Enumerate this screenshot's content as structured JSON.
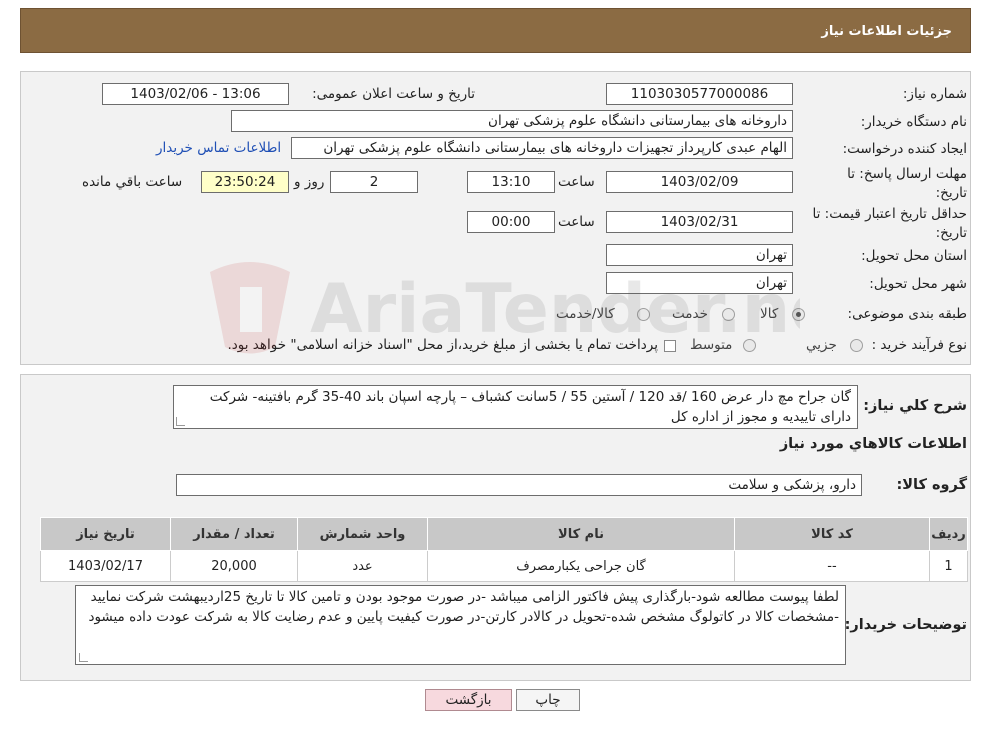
{
  "header": {
    "title": "جزئیات اطلاعات نیاز"
  },
  "details": {
    "need_number_label": "شماره نیاز:",
    "need_number": "1103030577000086",
    "announce_label": "تاریخ و ساعت اعلان عمومی:",
    "announce_value": "1403/02/06 - 13:06",
    "buyer_org_label": "نام دستگاه خریدار:",
    "buyer_org": "داروخانه های بیمارستانی دانشگاه علوم پزشکی تهران",
    "creator_label": "ایجاد کننده درخواست:",
    "creator": "الهام عبدی کارپرداز تجهیزات داروخانه های بیمارستانی دانشگاه علوم پزشکی تهران",
    "buyer_contact_link": "اطلاعات تماس خریدار",
    "reply_deadline_label": "مهلت ارسال پاسخ: تا تاریخ:",
    "reply_date": "1403/02/09",
    "time_label": "ساعت",
    "reply_time": "13:10",
    "days_value": "2",
    "days_label": "روز و",
    "remaining_time": "23:50:24",
    "remaining_label": "ساعت باقي مانده",
    "price_validity_label": "حداقل تاریخ اعتبار قیمت: تا تاریخ:",
    "price_date": "1403/02/31",
    "price_time": "00:00",
    "province_label": "استان محل تحویل:",
    "province": "تهران",
    "city_label": "شهر محل تحویل:",
    "city": "تهران",
    "category_label": "طبقه بندی موضوعی:",
    "category_options": [
      "کالا",
      "خدمت",
      "کالا/خدمت"
    ],
    "purchase_type_label": "نوع فرآیند خرید :",
    "purchase_options": [
      "جزیي",
      "متوسط"
    ],
    "payment_note": "پرداخت تمام یا بخشی از مبلغ خرید،از محل \"اسناد خزانه اسلامی\" خواهد بود."
  },
  "general": {
    "desc_label": "شرح کلي نياز:",
    "desc_text": "گان جراح مچ دار عرض 160 /قد 120 / آستین 55 / 5سانت کشباف – پارچه اسپان باند 40-35 گرم بافتینه- شرکت دارای تاییدیه و مجوز از اداره کل",
    "items_title": "اطلاعات کالاهاي مورد نياز",
    "group_label": "گروه کالا:",
    "group_value": "دارو، پزشکی و سلامت",
    "table": {
      "headers": [
        "رديف",
        "کد کالا",
        "نام کالا",
        "واحد شمارش",
        "تعداد / مقدار",
        "تاريخ نياز"
      ],
      "rows": [
        [
          "1",
          "--",
          "گان جراحی یکبارمصرف",
          "عدد",
          "20,000",
          "1403/02/17"
        ]
      ]
    },
    "buyer_notes_label": "توضیحات خریدار:",
    "buyer_notes": "لطفا پیوست مطالعه شود-بارگذاری پیش فاکتور الزامی میباشد -در صورت موجود بودن و تامین کالا تا تاریخ 25اردیبهشت شرکت نمایید -مشخصات کالا در کاتولوگ مشخص شده-تحویل در کالادر کارتن-در صورت کیفیت پایین و عدم رضایت کالا به شرکت عودت داده میشود"
  },
  "buttons": {
    "print": "چاپ",
    "back": "بازگشت"
  },
  "watermark": {
    "text": "AriaTender.neT"
  }
}
